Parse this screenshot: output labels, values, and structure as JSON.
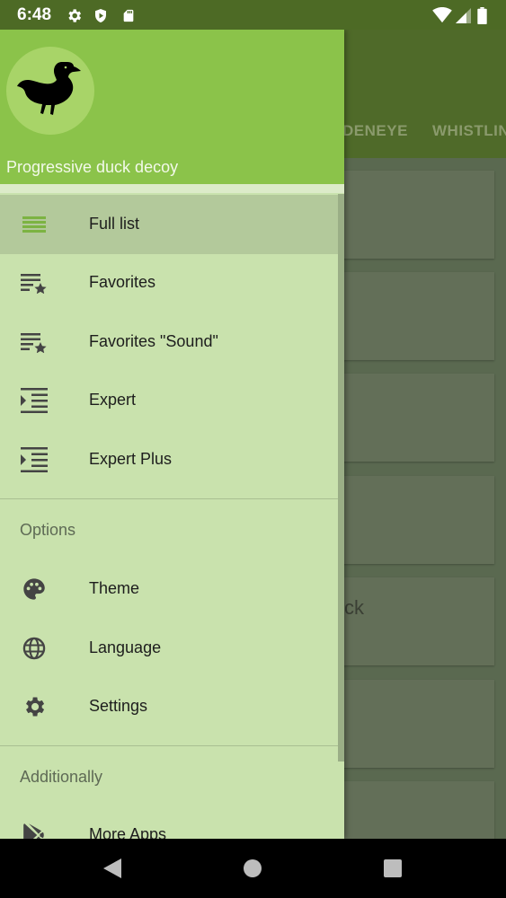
{
  "status_bar": {
    "time": "6:48",
    "left_icons": [
      "settings-icon",
      "shield-icon",
      "sd-card-icon"
    ],
    "right_icons": [
      "wifi-icon",
      "signal-icon",
      "battery-icon"
    ]
  },
  "background": {
    "tabs": [
      "DENEYE",
      "WHISTLIN"
    ],
    "partial_card_text": "ck"
  },
  "drawer": {
    "app_name": "Progressive duck decoy",
    "main_items": [
      {
        "label": "Full list",
        "icon": "list-icon",
        "active": true
      },
      {
        "label": "Favorites",
        "icon": "favorite-list-icon",
        "active": false
      },
      {
        "label": "Favorites \"Sound\"",
        "icon": "favorite-list-icon",
        "active": false
      },
      {
        "label": "Expert",
        "icon": "indent-list-icon",
        "active": false
      },
      {
        "label": "Expert Plus",
        "icon": "indent-list-icon",
        "active": false
      }
    ],
    "options_title": "Options",
    "options_items": [
      {
        "label": "Theme",
        "icon": "palette-icon"
      },
      {
        "label": "Language",
        "icon": "globe-icon"
      },
      {
        "label": "Settings",
        "icon": "gear-icon"
      }
    ],
    "additionally_title": "Additionally",
    "additionally_items": [
      {
        "label": "More Apps",
        "icon": "play-store-icon"
      }
    ]
  },
  "colors": {
    "header": "#8bc34a",
    "drawer_bg": "#c9e2ad",
    "active_item": "#b3c99b",
    "status_bar": "#4d6a25"
  }
}
